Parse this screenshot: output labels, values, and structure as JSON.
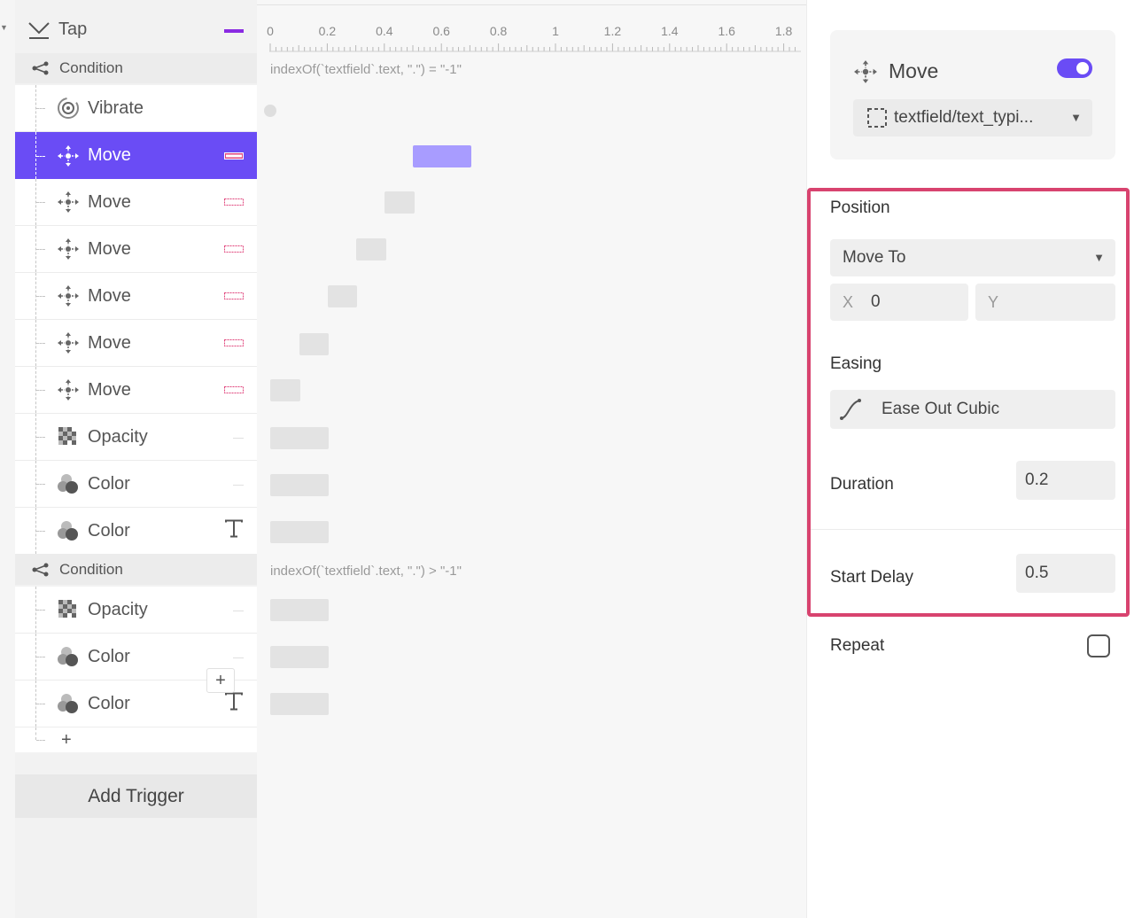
{
  "trigger": {
    "label": "Tap",
    "icon": "tap-icon"
  },
  "conditions": [
    {
      "label": "Condition",
      "expression": "indexOf(`textfield`.text, \".\") = \"-1\"",
      "items": [
        {
          "label": "Vibrate",
          "icon": "vibrate-icon"
        },
        {
          "label": "Move",
          "icon": "move-icon",
          "selected": true
        },
        {
          "label": "Move",
          "icon": "move-icon"
        },
        {
          "label": "Move",
          "icon": "move-icon"
        },
        {
          "label": "Move",
          "icon": "move-icon"
        },
        {
          "label": "Move",
          "icon": "move-icon"
        },
        {
          "label": "Move",
          "icon": "move-icon"
        },
        {
          "label": "Opacity",
          "icon": "opacity-icon"
        },
        {
          "label": "Color",
          "icon": "color-icon"
        },
        {
          "label": "Color",
          "icon": "color-icon"
        }
      ]
    },
    {
      "label": "Condition",
      "expression": "indexOf(`textfield`.text, \".\") > \"-1\"",
      "items": [
        {
          "label": "Opacity",
          "icon": "opacity-icon"
        },
        {
          "label": "Color",
          "icon": "color-icon"
        },
        {
          "label": "Color",
          "icon": "color-icon"
        }
      ]
    }
  ],
  "add_trigger_label": "Add Trigger",
  "plus_symbol": "+",
  "timeline": {
    "ticks": [
      "0",
      "0.2",
      "0.4",
      "0.6",
      "0.8",
      "1",
      "1.2",
      "1.4",
      "1.6",
      "1.8"
    ]
  },
  "inspector": {
    "title": "Move",
    "enabled": true,
    "target": "textfield/text_typi...",
    "position_label": "Position",
    "position_mode": "Move To",
    "x_label": "X",
    "x_value": "0",
    "y_label": "Y",
    "y_value": "",
    "easing_label": "Easing",
    "easing_value": "Ease Out Cubic",
    "duration_label": "Duration",
    "duration_value": "0.2",
    "start_delay_label": "Start Delay",
    "start_delay_value": "0.5",
    "repeat_label": "Repeat",
    "repeat_checked": false
  },
  "colors": {
    "accent": "#6a4cf5",
    "selected_bar": "#a89cff",
    "highlight_border": "#d8436f",
    "end_mark_pink": "#e0457c",
    "trigger_mark": "#8a2be2"
  }
}
